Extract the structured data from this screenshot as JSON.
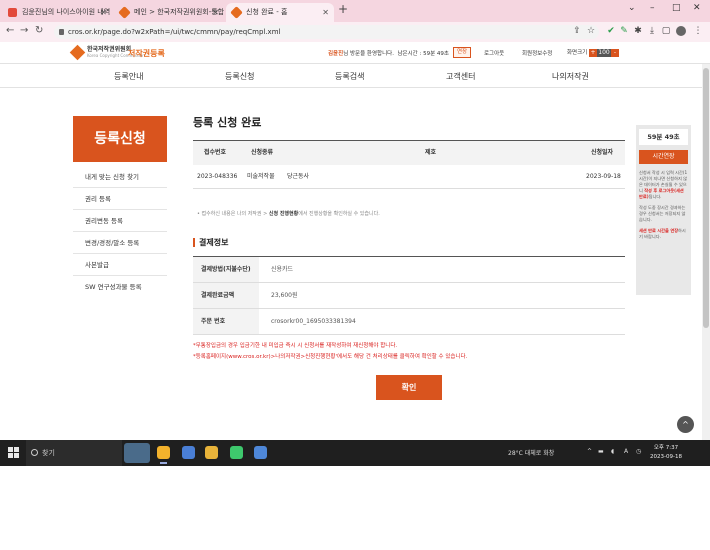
{
  "browser": {
    "tabs": [
      {
        "label": "김윤진님의 나이스아이원 내역 |",
        "color": "#e24a3b"
      },
      {
        "label": "메인 > 한국저작권위원회-통합:",
        "color": "#e56b1f"
      },
      {
        "label": "신청 완료 - 홈",
        "color": "#e56b1f"
      }
    ],
    "new_tab": "+",
    "window_controls": [
      "⌄",
      "–",
      "□",
      "✕"
    ],
    "url": "cros.or.kr/page.do?w2xPath=/ui/twc/cmmn/pay/reqCmpl.xml"
  },
  "site": {
    "logo_org": "한국저작권위원회",
    "logo_sub": "Korea Copyright Commission",
    "logo_title": "저작권등록",
    "user_name": "김윤진",
    "user_greeting": "님 방문을 환영합니다.",
    "session_label": "남은시간 : 59분 49초",
    "extend_label": "연장",
    "top_links": [
      "로그아웃",
      "회원정보수정"
    ],
    "zoom_label": "화면크기",
    "zoom_plus": "+",
    "zoom_value": "100",
    "zoom_minus": "-",
    "gnb": [
      "등록안내",
      "등록신청",
      "등록검색",
      "고객센터",
      "나의저작권"
    ]
  },
  "sidebar": {
    "title": "등록신청",
    "items": [
      "내게 맞는 신청 찾기",
      "권리 등록",
      "권리변동 등록",
      "변경/경정/말소 등록",
      "사본발급",
      "SW 연구성과물 등록"
    ]
  },
  "main": {
    "title": "등록 신청 완료",
    "table_headers": [
      "접수번호",
      "신청종류",
      "제호",
      "신청일자"
    ],
    "rows": [
      {
        "receipt_no": "2023-048336",
        "type": "미술저작물",
        "subject": "당근동사",
        "date": "2023-09-18"
      }
    ],
    "notice_prefix": "• 접수하신 내용은 나의 저작권 > ",
    "notice_bold": "신청 진행현황",
    "notice_suffix": "에서 진행상황을 확인하실 수 있습니다.",
    "payment_title": "결제정보",
    "payment_rows": [
      {
        "label": "결제방법(지불수단)",
        "value": "신용카드"
      },
      {
        "label": "결제완료금액",
        "value": "23,600원"
      },
      {
        "label": "주문 번호",
        "value": "crosorkr00_1695033381394"
      }
    ],
    "warnings": [
      "*무통장입금의 경우 입금기한 내 미입금 즉시 시 신청서를 재작성하여 재신청해야 합니다.",
      "*등록홈페이지(www.cros.or.kr)>나의저작권>신청진행현황'에서도 해당 건 처리상태를 클릭하여 확인할 수 있습니다."
    ],
    "confirm_label": "확인"
  },
  "session_box": {
    "time": "59분 49초",
    "extend": "시간연장",
    "text1": "신청서 작성 시 입력 시간(1시간)이 지나면 신청하지 않은 데이터가 손실될 수 있으니 ",
    "text1_red": "작성 후 로그아웃(세션 만료)",
    "text1_end": "됩니다.",
    "text2": "작성 도중 장시간 경과하는 경우 신청서는 저장되지 않습니다.",
    "text3_red": "세션 만료 시간을 연장",
    "text3": "하시기 바랍니다."
  },
  "scroll_top": "^",
  "taskbar": {
    "search": "찾기",
    "weather": "28°C 대체로 화창",
    "ime": "A",
    "time": "오후 7:37",
    "date": "2023-09-18"
  },
  "colors": {
    "accent": "#d9541e",
    "warning": "#d9201e",
    "tab_bar": "#f5d6e0"
  }
}
